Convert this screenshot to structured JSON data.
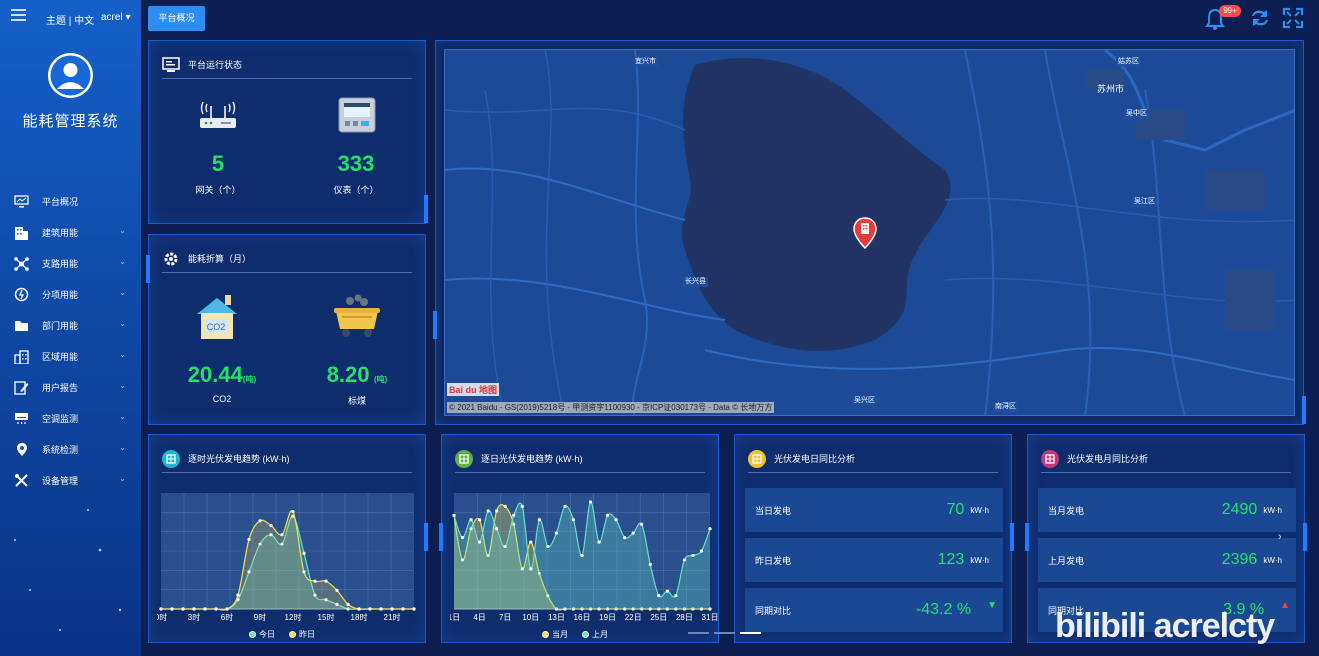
{
  "sidebar": {
    "theme_link": "主题 | 中文",
    "user": "acrel ▾",
    "app_title": "能耗管理系统",
    "items": [
      {
        "label": "平台概况",
        "icon": "monitor-icon",
        "has_children": false
      },
      {
        "label": "建筑用能",
        "icon": "building-icon",
        "has_children": true
      },
      {
        "label": "支路用能",
        "icon": "branch-icon",
        "has_children": true
      },
      {
        "label": "分项用能",
        "icon": "gauge-icon",
        "has_children": true
      },
      {
        "label": "部门用能",
        "icon": "folder-icon",
        "has_children": true
      },
      {
        "label": "区域用能",
        "icon": "region-icon",
        "has_children": true
      },
      {
        "label": "用户报告",
        "icon": "report-icon",
        "has_children": true
      },
      {
        "label": "空调监测",
        "icon": "aircon-icon",
        "has_children": true
      },
      {
        "label": "系统检测",
        "icon": "location-icon",
        "has_children": true
      },
      {
        "label": "设备管理",
        "icon": "tools-icon",
        "has_children": true
      }
    ]
  },
  "topbar": {
    "tab": "平台概况",
    "badge": "99+",
    "icons": [
      "bell-icon",
      "refresh-icon",
      "fullscreen-icon"
    ]
  },
  "status_panel": {
    "title": "平台运行状态",
    "gateway_value": "5",
    "gateway_label": "网关（个）",
    "meter_value": "333",
    "meter_label": "仪表（个）"
  },
  "energy_panel": {
    "title": "能耗折算（月）",
    "co2_value": "20.44",
    "co2_unit": "(吨)",
    "co2_label": "CO2",
    "coal_value": "8.20",
    "coal_unit": "(吨)",
    "coal_label": "标煤",
    "co2_icon_text": "CO2"
  },
  "map": {
    "labels": [
      "宜兴市",
      "苏州市",
      "姑苏区",
      "吴中区",
      "吴江区",
      "长兴县",
      "吴兴区",
      "南浔区"
    ],
    "copyright": "© 2021 Baidu - GS(2019)5218号 - 甲测资字1100930 - 京ICP证030173号 - Data © 长地万方",
    "logo": "Bai du 地图"
  },
  "hourly_panel": {
    "title": "逐时光伏发电趋势 (kW·h)",
    "legend": [
      "今日",
      "昨日"
    ]
  },
  "daily_panel": {
    "title": "逐日光伏发电趋势 (kW·h)",
    "legend": [
      "当月",
      "上月"
    ]
  },
  "day_compare": {
    "title": "光伏发电日同比分析",
    "rows": [
      {
        "label": "当日发电",
        "value": "70",
        "unit": "kW·h"
      },
      {
        "label": "昨日发电",
        "value": "123",
        "unit": "kW·h"
      },
      {
        "label": "同期对比",
        "value": "-43.2 %",
        "unit": ""
      }
    ]
  },
  "month_compare": {
    "title": "光伏发电月同比分析",
    "rows": [
      {
        "label": "当月发电",
        "value": "2490",
        "unit": "kW·h"
      },
      {
        "label": "上月发电",
        "value": "2396",
        "unit": "kW·h"
      },
      {
        "label": "同期对比",
        "value": "3.9 %",
        "unit": ""
      }
    ]
  },
  "watermark": "bilibili acrelcty",
  "colors": {
    "accent": "#22e06a",
    "line_today": "#66e0c8",
    "line_yesterday": "#f5e04a",
    "up_arrow": "#ff3b3b",
    "down_arrow": "#22e06a"
  },
  "chart_data": [
    {
      "type": "line",
      "x": [
        "0时",
        "1时",
        "2时",
        "3时",
        "4时",
        "5时",
        "6时",
        "7时",
        "8时",
        "9时",
        "10时",
        "11时",
        "12时",
        "13时",
        "14时",
        "15时",
        "16时",
        "17时",
        "18时",
        "19时",
        "20时",
        "21时",
        "22时",
        "23时"
      ],
      "tick_labels": [
        "0时",
        "3时",
        "6时",
        "9时",
        "12时",
        "15时",
        "18时",
        "21时"
      ],
      "series": [
        {
          "name": "今日",
          "values": [
            0,
            0,
            0,
            0,
            0,
            0,
            0,
            2,
            8,
            14,
            16,
            14,
            20,
            12,
            3,
            2,
            1,
            0,
            0,
            0,
            0,
            0,
            0,
            0
          ]
        },
        {
          "name": "昨日",
          "values": [
            0,
            0,
            0,
            0,
            0,
            0,
            0,
            3,
            15,
            19,
            18,
            16,
            21,
            8,
            6,
            6,
            4,
            1,
            0,
            0,
            0,
            0,
            0,
            0
          ]
        }
      ],
      "ylim": [
        0,
        25
      ]
    },
    {
      "type": "line",
      "x": [
        1,
        2,
        3,
        4,
        5,
        6,
        7,
        8,
        9,
        10,
        11,
        12,
        13,
        14,
        15,
        16,
        17,
        18,
        19,
        20,
        21,
        22,
        23,
        24,
        25,
        26,
        27,
        28,
        29,
        30,
        31
      ],
      "tick_labels": [
        "1日",
        "4日",
        "7日",
        "10日",
        "13日",
        "16日",
        "19日",
        "22日",
        "25日",
        "28日",
        "31日"
      ],
      "series": [
        {
          "name": "当月",
          "values": [
            21,
            11,
            18,
            20,
            12,
            22,
            23,
            19,
            9,
            15,
            8,
            3,
            0,
            0,
            0,
            0,
            0,
            0,
            0,
            0,
            0,
            0,
            0,
            0,
            0,
            0,
            0,
            0,
            0,
            0,
            0
          ]
        },
        {
          "name": "上月",
          "values": [
            21,
            16,
            20,
            15,
            22,
            18,
            14,
            21,
            23,
            9,
            20,
            14,
            17,
            23,
            20,
            12,
            24,
            15,
            21,
            20,
            16,
            17,
            19,
            10,
            3,
            4,
            3,
            11,
            12,
            13,
            18
          ]
        }
      ],
      "ylim": [
        0,
        26
      ]
    }
  ]
}
